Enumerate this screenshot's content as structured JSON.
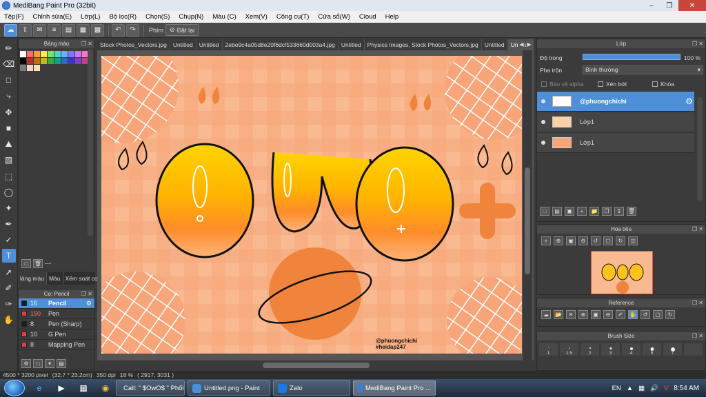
{
  "window": {
    "title": "MediBang Paint Pro (32bit)",
    "minimize_icon": "minimize-icon",
    "maximize_icon": "restore-icon",
    "close_icon": "close-icon"
  },
  "menu": [
    "Tệp(F)",
    "Chỉnh sửa(E)",
    "Lớp(L)",
    "Bộ lọc(R)",
    "Chọn(S)",
    "Chụp(N)",
    "Màu (C)",
    "Xem(V)",
    "Công cụ(T)",
    "Cửa sổ(W)",
    "Cloud",
    "Help"
  ],
  "toolbar": {
    "key_label": "Phím",
    "reset_label": "Đặt lại"
  },
  "palette": {
    "title": "Bảng màu",
    "colors": [
      "#ffffff",
      "#ff6a6a",
      "#ff9a3a",
      "#ffe84a",
      "#7ee36a",
      "#4ad9c8",
      "#6ab0ff",
      "#7a74ff",
      "#c974ff",
      "#ff74c9",
      "#000000",
      "#c82a2a",
      "#c86a1a",
      "#c8b41a",
      "#3aa83a",
      "#1a9a8a",
      "#2a6ac8",
      "#3a3ab8",
      "#8a3ac8",
      "#c83a8a",
      "#7a7a7a",
      "#ffd0c0",
      "#ffe0b0"
    ],
    "tabs": [
      "lảng màu",
      "Màu",
      "Xếm soát cọ"
    ],
    "dash": "---"
  },
  "brush_panel": {
    "title": "Cọ: Pencil",
    "brushes": [
      {
        "size": "16",
        "name": "Pencil",
        "color": "#1a1a1a",
        "selected": true
      },
      {
        "size": "150",
        "name": "Pen",
        "color": "#e04040",
        "selected": false
      },
      {
        "size": "8",
        "name": "Pen (Sharp)",
        "color": "#1a1a1a",
        "selected": false
      },
      {
        "size": "10",
        "name": "G Pen",
        "color": "#e04040",
        "selected": false
      },
      {
        "size": "8",
        "name": "Mapping Pen",
        "color": "#e04040",
        "selected": false
      }
    ]
  },
  "doc_tabs": [
    " Stock Photos_Vectors.jpg",
    "Untitled",
    "Untitled",
    "2ebe9c4a05d8e20f6dcf533660d003a4.jpg",
    "Untitled",
    "Physics Images, Stock Photos_Vectors.jpg",
    "Untitled",
    "Untitled"
  ],
  "artwork": {
    "watermark_line1": "@phuongchichi",
    "watermark_line2": "#heidap247"
  },
  "status": {
    "size": "4500 * 3200 pixel",
    "cm": "(32.7 * 23.2cm)",
    "dpi": "350 dpi",
    "zoom": "18 %",
    "coords": "( 2917, 3031 )"
  },
  "layers": {
    "title": "Lớp",
    "opacity_label": "Độ trong",
    "opacity_value": "100 %",
    "blend_label": "Pha trộn",
    "blend_value": "Bình thường",
    "protect_alpha": "Bảo vệ alpha",
    "clipping": "Xén bớt",
    "lock": "Khóa",
    "items": [
      {
        "name": "@phuongchichi",
        "selected": true
      },
      {
        "name": "Lớp1",
        "selected": false
      },
      {
        "name": "Lớp1",
        "selected": false
      }
    ]
  },
  "navigator": {
    "title": "Hoa tiêu"
  },
  "reference": {
    "title": "Reference"
  },
  "brush_size": {
    "title": "Brush Size",
    "sizes": [
      "1",
      "1.5",
      "2",
      "3",
      "4",
      "5",
      "7",
      ""
    ]
  },
  "taskbar": {
    "tasks": [
      {
        "label": "Call: \" $OwO$ \" Phối...",
        "icon_color": "#ff7a2a"
      },
      {
        "label": "Untitled.png - Paint",
        "icon_color": "#4a90d9"
      },
      {
        "label": "Zalo",
        "icon_color": "#1a7ae0"
      },
      {
        "label": "MediBang Paint Pro ...",
        "icon_color": "#3a7fd5"
      }
    ],
    "language": "EN",
    "time": "8:54 AM"
  }
}
